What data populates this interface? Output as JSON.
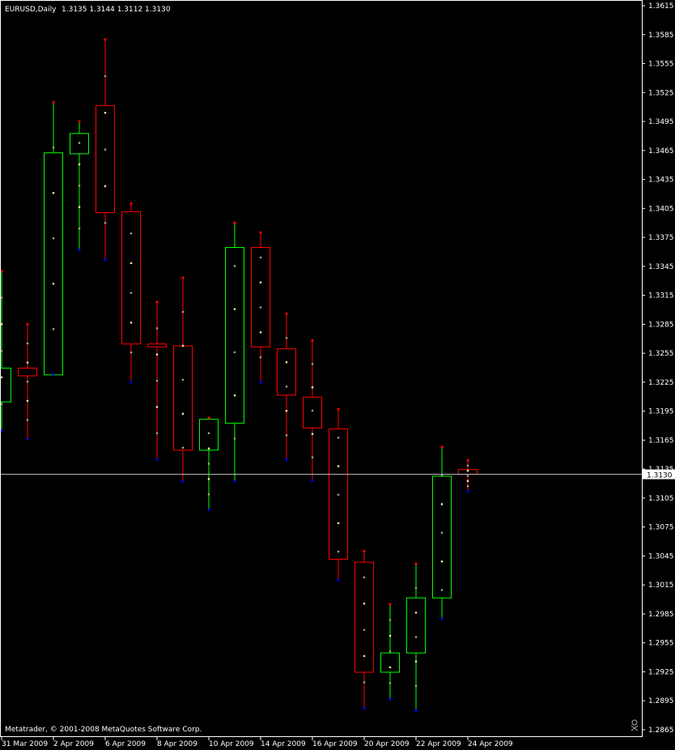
{
  "header": {
    "symbol_label": "EURUSD,Daily",
    "ohlc_label": "1.3135 1.3144 1.3112 1.3130"
  },
  "footer": {
    "copyright": "Metatrader, © 2001-2008 MetaQuotes Software Corp."
  },
  "colors": {
    "background": "#000000",
    "bull": "#00ff00",
    "bear": "#ff0000",
    "wick_high": "#ff0000",
    "wick_low": "#0000ff",
    "axis": "#ffffff",
    "current_price_line": "#c0c0c0"
  },
  "chart_data": {
    "type": "candlestick",
    "symbol": "EURUSD",
    "timeframe": "Daily",
    "current_price": 1.313,
    "ylim": [
      1.2865,
      1.3615
    ],
    "y_ticks": [
      1.3615,
      1.3585,
      1.3555,
      1.3525,
      1.3495,
      1.3465,
      1.3435,
      1.3405,
      1.3375,
      1.3345,
      1.3315,
      1.3285,
      1.3255,
      1.3225,
      1.3195,
      1.3165,
      1.3135,
      1.3105,
      1.3075,
      1.3045,
      1.3015,
      1.2985,
      1.2955,
      1.2925,
      1.2895,
      1.2865
    ],
    "x_labels": [
      "31 Mar 2009",
      "2 Apr 2009",
      "6 Apr 2009",
      "8 Apr 2009",
      "10 Apr 2009",
      "14 Apr 2009",
      "16 Apr 2009",
      "20 Apr 2009",
      "22 Apr 2009",
      "24 Apr 2009"
    ],
    "x_label_candle_index": [
      0,
      2,
      4,
      6,
      8,
      10,
      12,
      14,
      16,
      18
    ],
    "candles": [
      {
        "o": 1.3205,
        "h": 1.334,
        "l": 1.3175,
        "c": 1.324
      },
      {
        "o": 1.324,
        "h": 1.3285,
        "l": 1.3166,
        "c": 1.3232
      },
      {
        "o": 1.3233,
        "h": 1.3515,
        "l": 1.3233,
        "c": 1.3463
      },
      {
        "o": 1.3462,
        "h": 1.3495,
        "l": 1.3362,
        "c": 1.3483
      },
      {
        "o": 1.3512,
        "h": 1.358,
        "l": 1.3352,
        "c": 1.3401
      },
      {
        "o": 1.3402,
        "h": 1.341,
        "l": 1.3225,
        "c": 1.3265
      },
      {
        "o": 1.3265,
        "h": 1.3308,
        "l": 1.3145,
        "c": 1.3262
      },
      {
        "o": 1.3263,
        "h": 1.3333,
        "l": 1.3122,
        "c": 1.3155
      },
      {
        "o": 1.3155,
        "h": 1.3188,
        "l": 1.3093,
        "c": 1.3187
      },
      {
        "o": 1.3183,
        "h": 1.339,
        "l": 1.3122,
        "c": 1.3365
      },
      {
        "o": 1.3365,
        "h": 1.338,
        "l": 1.3225,
        "c": 1.3262
      },
      {
        "o": 1.326,
        "h": 1.3296,
        "l": 1.3145,
        "c": 1.3212
      },
      {
        "o": 1.321,
        "h": 1.3268,
        "l": 1.3123,
        "c": 1.3178
      },
      {
        "o": 1.3177,
        "h": 1.3197,
        "l": 1.302,
        "c": 1.3042
      },
      {
        "o": 1.3039,
        "h": 1.305,
        "l": 1.2887,
        "c": 1.2925
      },
      {
        "o": 1.2925,
        "h": 1.2995,
        "l": 1.2897,
        "c": 1.2945
      },
      {
        "o": 1.2945,
        "h": 1.3037,
        "l": 1.2885,
        "c": 1.3002
      },
      {
        "o": 1.3002,
        "h": 1.3158,
        "l": 1.298,
        "c": 1.3128
      },
      {
        "o": 1.3135,
        "h": 1.3144,
        "l": 1.3112,
        "c": 1.313
      }
    ]
  }
}
